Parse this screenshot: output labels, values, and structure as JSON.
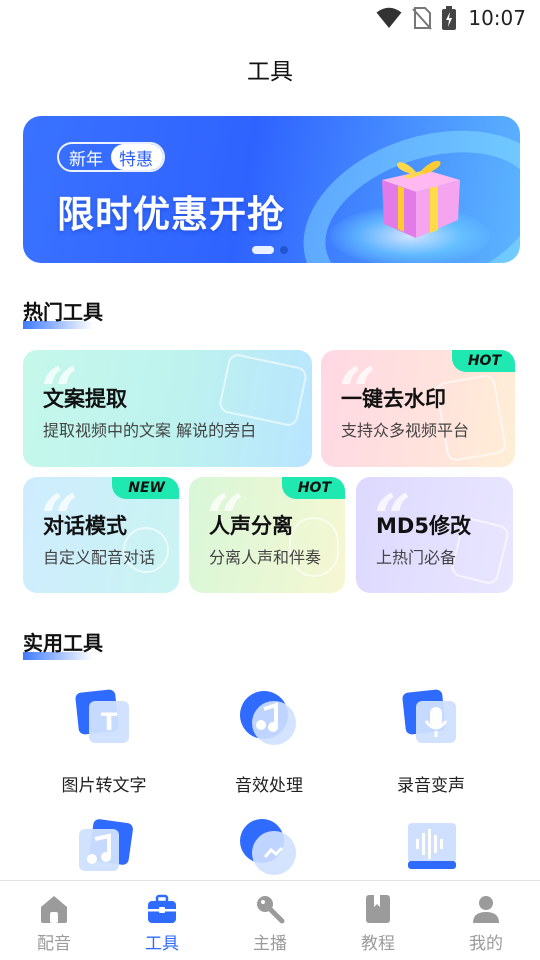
{
  "status_bar": {
    "time": "10:07"
  },
  "page": {
    "title": "工具"
  },
  "banner": {
    "badge_left": "新年",
    "badge_right": "特惠",
    "headline": "限时优惠开抢"
  },
  "hot_tools": {
    "title": "热门工具",
    "cards": [
      {
        "title": "文案提取",
        "subtitle": "提取视频中的文案 解说的旁白",
        "tag": ""
      },
      {
        "title": "一键去水印",
        "subtitle": "支持众多视频平台",
        "tag": "HOT"
      },
      {
        "title": "对话模式",
        "subtitle": "自定义配音对话",
        "tag": "NEW"
      },
      {
        "title": "人声分离",
        "subtitle": "分离人声和伴奏",
        "tag": "HOT"
      },
      {
        "title": "MD5修改",
        "subtitle": "上热门必备",
        "tag": ""
      }
    ]
  },
  "practical_tools": {
    "title": "实用工具",
    "items": [
      {
        "label": "图片转文字",
        "icon": "image-to-text-icon"
      },
      {
        "label": "音效处理",
        "icon": "sound-effect-icon"
      },
      {
        "label": "录音变声",
        "icon": "voice-changer-icon"
      },
      {
        "label": "",
        "icon": "music-icon"
      },
      {
        "label": "",
        "icon": "chat-icon"
      },
      {
        "label": "",
        "icon": "audio-wave-icon"
      }
    ]
  },
  "bottom_nav": {
    "items": [
      {
        "label": "配音",
        "icon": "home-icon",
        "active": false
      },
      {
        "label": "工具",
        "icon": "toolbox-icon",
        "active": true
      },
      {
        "label": "主播",
        "icon": "microphone-icon",
        "active": false
      },
      {
        "label": "教程",
        "icon": "book-icon",
        "active": false
      },
      {
        "label": "我的",
        "icon": "profile-icon",
        "active": false
      }
    ]
  },
  "colors": {
    "accent": "#2f6bff",
    "tag_green": "#1fe8b0",
    "nav_inactive": "#9b9b9b"
  }
}
